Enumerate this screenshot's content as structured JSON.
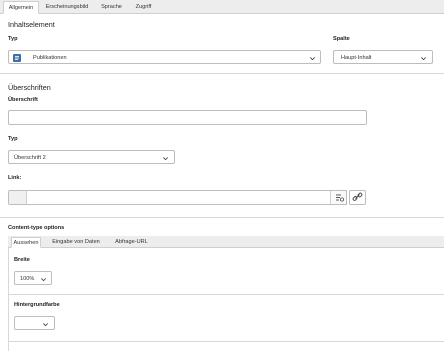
{
  "tabs": [
    "Allgemein",
    "Erscheinungsbild",
    "Sprache",
    "Zugriff"
  ],
  "section_element": {
    "title": "Inhaltselement",
    "type_label": "Typ",
    "type_value": "Publikationen",
    "column_label": "Spalte",
    "column_value": "Haupt-Inhalt"
  },
  "section_headlines": {
    "title": "Überschriften",
    "headline_label": "Überschrift",
    "headline_value": "",
    "type_label": "Typ",
    "type_value": "Überschrift 2",
    "link_label": "Link:",
    "link_value": ""
  },
  "content_type_options": {
    "title": "Content-type options",
    "subtabs": [
      "Aussehen",
      "Eingabe von Daten",
      "Abfrage-URL"
    ],
    "width_label": "Breite",
    "width_value": "100%",
    "bgcolor_label": "Hintergrundfarbe",
    "bgcolor_value": ""
  },
  "icons": {
    "type_icon": "publication-icon",
    "link_browse_icon": "link-browser-icon",
    "link_icon": "chain-link-icon"
  }
}
